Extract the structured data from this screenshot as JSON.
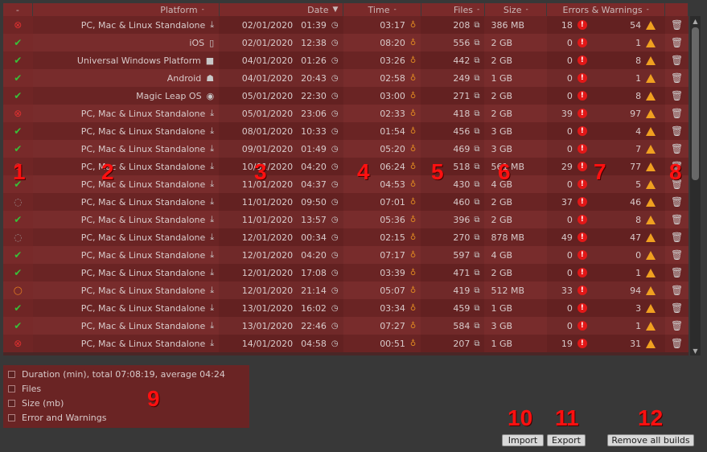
{
  "header": {
    "status": "-",
    "platform": "Platform",
    "date": "Date",
    "time": "Time",
    "files": "Files",
    "size": "Size",
    "errors_warnings": "Errors & Warnings",
    "sort_minus": "-",
    "sort_desc": "▼"
  },
  "rows": [
    {
      "status": "error",
      "platform": "PC, Mac & Linux Standalone",
      "platform_icon": "download-icon",
      "date": "02/01/2020",
      "clock": "01:39",
      "time": "03:17",
      "files": "208",
      "size": "386 MB",
      "errors": "18",
      "warnings": "54"
    },
    {
      "status": "ok",
      "platform": "iOS",
      "platform_icon": "phone-icon",
      "date": "02/01/2020",
      "clock": "12:38",
      "time": "08:20",
      "files": "556",
      "size": "2 GB",
      "errors": "0",
      "warnings": "1"
    },
    {
      "status": "ok",
      "platform": "Universal Windows Platform",
      "platform_icon": "windows-icon",
      "date": "04/01/2020",
      "clock": "01:26",
      "time": "03:26",
      "files": "442",
      "size": "2 GB",
      "errors": "0",
      "warnings": "8"
    },
    {
      "status": "ok",
      "platform": "Android",
      "platform_icon": "android-icon",
      "date": "04/01/2020",
      "clock": "20:43",
      "time": "02:58",
      "files": "249",
      "size": "1 GB",
      "errors": "0",
      "warnings": "1"
    },
    {
      "status": "ok",
      "platform": "Magic Leap OS",
      "platform_icon": "magic-leap-icon",
      "date": "05/01/2020",
      "clock": "22:30",
      "time": "03:00",
      "files": "271",
      "size": "2 GB",
      "errors": "0",
      "warnings": "8"
    },
    {
      "status": "error",
      "platform": "PC, Mac & Linux Standalone",
      "platform_icon": "download-icon",
      "date": "05/01/2020",
      "clock": "23:06",
      "time": "02:33",
      "files": "418",
      "size": "2 GB",
      "errors": "39",
      "warnings": "97"
    },
    {
      "status": "ok",
      "platform": "PC, Mac & Linux Standalone",
      "platform_icon": "download-icon",
      "date": "08/01/2020",
      "clock": "10:33",
      "time": "01:54",
      "files": "456",
      "size": "3 GB",
      "errors": "0",
      "warnings": "4"
    },
    {
      "status": "ok",
      "platform": "PC, Mac & Linux Standalone",
      "platform_icon": "download-icon",
      "date": "09/01/2020",
      "clock": "01:49",
      "time": "05:20",
      "files": "469",
      "size": "3 GB",
      "errors": "0",
      "warnings": "7"
    },
    {
      "status": "error",
      "platform": "PC, Mac & Linux Standalone",
      "platform_icon": "download-icon",
      "date": "10/01/2020",
      "clock": "04:20",
      "time": "06:24",
      "files": "518",
      "size": "561 MB",
      "errors": "29",
      "warnings": "77"
    },
    {
      "status": "ok",
      "platform": "PC, Mac & Linux Standalone",
      "platform_icon": "download-icon",
      "date": "11/01/2020",
      "clock": "04:37",
      "time": "04:53",
      "files": "430",
      "size": "4 GB",
      "errors": "0",
      "warnings": "5"
    },
    {
      "status": "pending",
      "platform": "PC, Mac & Linux Standalone",
      "platform_icon": "download-icon",
      "date": "11/01/2020",
      "clock": "09:50",
      "time": "07:01",
      "files": "460",
      "size": "2 GB",
      "errors": "37",
      "warnings": "46"
    },
    {
      "status": "ok",
      "platform": "PC, Mac & Linux Standalone",
      "platform_icon": "download-icon",
      "date": "11/01/2020",
      "clock": "13:57",
      "time": "05:36",
      "files": "396",
      "size": "2 GB",
      "errors": "0",
      "warnings": "8"
    },
    {
      "status": "pending",
      "platform": "PC, Mac & Linux Standalone",
      "platform_icon": "download-icon",
      "date": "12/01/2020",
      "clock": "00:34",
      "time": "02:15",
      "files": "270",
      "size": "878 MB",
      "errors": "49",
      "warnings": "47"
    },
    {
      "status": "ok",
      "platform": "PC, Mac & Linux Standalone",
      "platform_icon": "download-icon",
      "date": "12/01/2020",
      "clock": "04:20",
      "time": "07:17",
      "files": "597",
      "size": "4 GB",
      "errors": "0",
      "warnings": "0"
    },
    {
      "status": "ok",
      "platform": "PC, Mac & Linux Standalone",
      "platform_icon": "download-icon",
      "date": "12/01/2020",
      "clock": "17:08",
      "time": "03:39",
      "files": "471",
      "size": "2 GB",
      "errors": "0",
      "warnings": "1"
    },
    {
      "status": "warning",
      "platform": "PC, Mac & Linux Standalone",
      "platform_icon": "download-icon",
      "date": "12/01/2020",
      "clock": "21:14",
      "time": "05:07",
      "files": "419",
      "size": "512 MB",
      "errors": "33",
      "warnings": "94"
    },
    {
      "status": "ok",
      "platform": "PC, Mac & Linux Standalone",
      "platform_icon": "download-icon",
      "date": "13/01/2020",
      "clock": "16:02",
      "time": "03:34",
      "files": "459",
      "size": "1 GB",
      "errors": "0",
      "warnings": "3"
    },
    {
      "status": "ok",
      "platform": "PC, Mac & Linux Standalone",
      "platform_icon": "download-icon",
      "date": "13/01/2020",
      "clock": "22:46",
      "time": "07:27",
      "files": "584",
      "size": "3 GB",
      "errors": "0",
      "warnings": "1"
    },
    {
      "status": "error",
      "platform": "PC, Mac & Linux Standalone",
      "platform_icon": "download-icon",
      "date": "14/01/2020",
      "clock": "04:58",
      "time": "00:51",
      "files": "207",
      "size": "1 GB",
      "errors": "19",
      "warnings": "31"
    }
  ],
  "options": {
    "duration": "Duration (min), total 07:08:19, average 04:24",
    "files": "Files",
    "size": "Size (mb)",
    "errors": "Error and Warnings"
  },
  "buttons": {
    "import": "Import",
    "export": "Export",
    "remove_all": "Remove all builds"
  },
  "annotations": [
    "1",
    "2",
    "3",
    "4",
    "5",
    "6",
    "7",
    "8",
    "9",
    "10",
    "11",
    "12"
  ],
  "colors": {
    "ok": "#38c038",
    "error": "#e03030",
    "warning": "#e07a20",
    "row_even": "#6a2424",
    "row_odd": "#782c2c"
  }
}
